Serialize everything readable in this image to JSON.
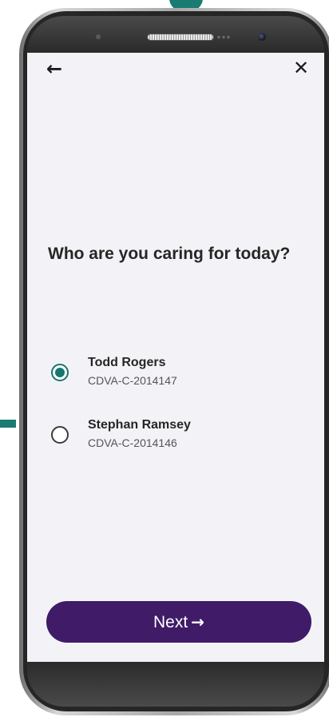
{
  "nav": {
    "back_icon": "arrow-left-icon",
    "back_glyph": "←",
    "close_icon": "close-icon",
    "close_glyph": "✕"
  },
  "question": {
    "title": "Who are you caring for today?"
  },
  "options": [
    {
      "name": "Todd Rogers",
      "id": "CDVA-C-2014147",
      "selected": true
    },
    {
      "name": "Stephan Ramsey",
      "id": "CDVA-C-2014146",
      "selected": false
    }
  ],
  "next_button": {
    "label": "Next",
    "arrow_glyph": "→"
  },
  "colors": {
    "accent_teal": "#16776f",
    "button_purple": "#3f1b68",
    "screen_bg": "#f3f3f7"
  }
}
